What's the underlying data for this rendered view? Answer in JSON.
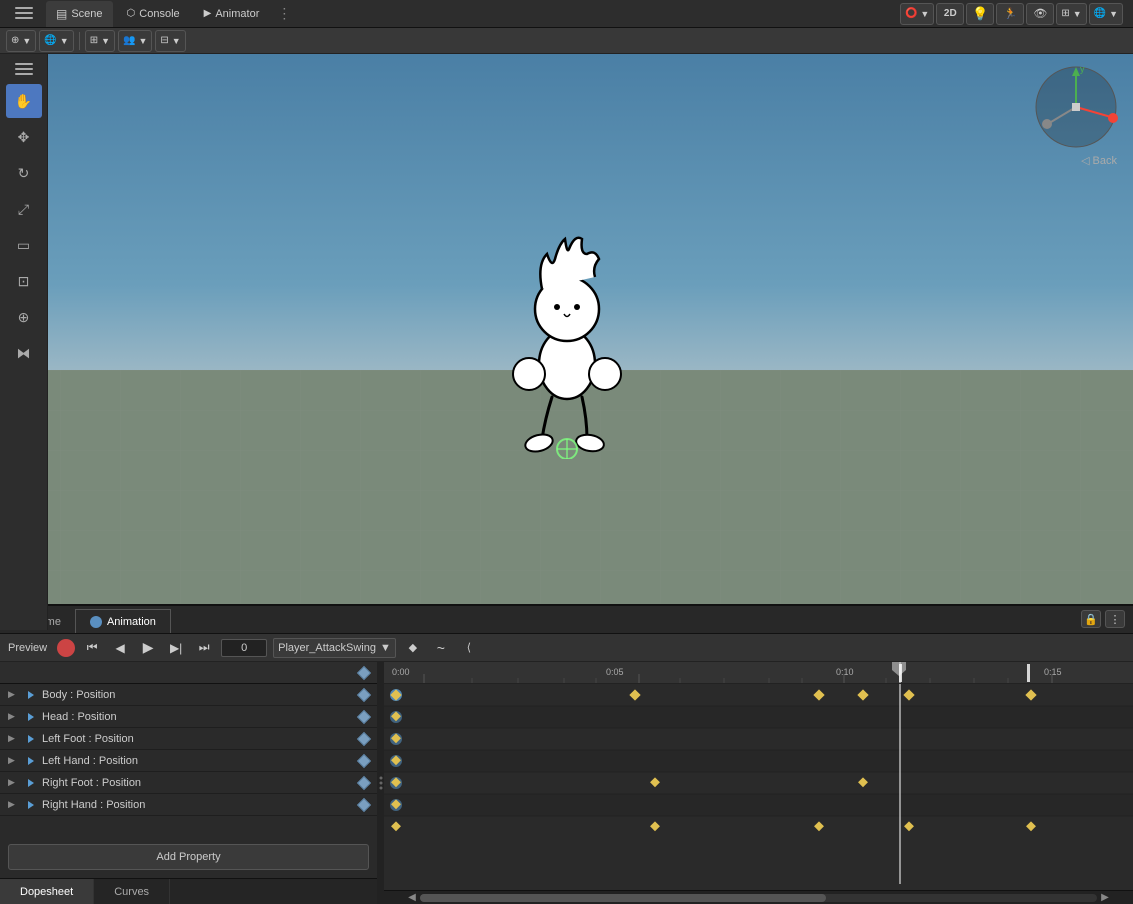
{
  "topBar": {
    "tabs": [
      {
        "id": "scene",
        "label": "Scene",
        "icon": "▤",
        "active": true
      },
      {
        "id": "console",
        "label": "Console",
        "icon": "⬡",
        "active": false
      },
      {
        "id": "animator",
        "label": "Animator",
        "icon": "▶",
        "active": false
      }
    ],
    "overflow_icon": "⋮",
    "toolbar_items": [
      "⊕",
      "🌐",
      "⊞",
      "📷",
      "⊟"
    ],
    "right_items": [
      "⭕",
      "2D",
      "💡",
      "🏃",
      "👁",
      "📹",
      "🌐"
    ]
  },
  "leftTools": {
    "tools": [
      {
        "id": "hand",
        "icon": "✋",
        "active": true
      },
      {
        "id": "move",
        "icon": "✥",
        "active": false
      },
      {
        "id": "rotate",
        "icon": "↻",
        "active": false
      },
      {
        "id": "scale",
        "icon": "⤢",
        "active": false
      },
      {
        "id": "rect",
        "icon": "▭",
        "active": false
      },
      {
        "id": "transform",
        "icon": "⊡",
        "active": false
      },
      {
        "id": "custom1",
        "icon": "⊕",
        "active": false
      },
      {
        "id": "custom2",
        "icon": "⧓",
        "active": false
      }
    ]
  },
  "scene": {
    "back_label": "◁ Back",
    "character_desc": "animated character stick figure"
  },
  "bottomPanel": {
    "tabs": [
      {
        "id": "game",
        "label": "Game",
        "icon": "🎮",
        "active": false
      },
      {
        "id": "animation",
        "label": "Animation",
        "icon": "●",
        "active": true
      }
    ],
    "preview_label": "Preview",
    "record_btn": "●",
    "transport_buttons": [
      "⏮",
      "⏭←",
      "◀",
      "▶",
      "▶▶",
      "⏭"
    ],
    "frame_value": "0",
    "clip_name": "Player_AttackSwing",
    "clip_arrow": "▼",
    "add_keyframe_icon": "◆",
    "anim_curve_icon": "~",
    "collapse_icon": "⟨"
  },
  "propertyPanel": {
    "properties": [
      {
        "id": "body-pos",
        "label": "Body : Position",
        "has_keyframe": true
      },
      {
        "id": "head-pos",
        "label": "Head : Position",
        "has_keyframe": true
      },
      {
        "id": "left-foot-pos",
        "label": "Left Foot : Position",
        "has_keyframe": true
      },
      {
        "id": "left-hand-pos",
        "label": "Left Hand : Position",
        "has_keyframe": true
      },
      {
        "id": "right-foot-pos",
        "label": "Right Foot : Position",
        "has_keyframe": true
      },
      {
        "id": "right-hand-pos",
        "label": "Right Hand : Position",
        "has_keyframe": true
      }
    ],
    "add_property_label": "Add Property"
  },
  "bottomTabs": {
    "tabs": [
      {
        "id": "dopesheet",
        "label": "Dopesheet",
        "active": true
      },
      {
        "id": "curves",
        "label": "Curves",
        "active": false
      }
    ]
  },
  "timeline": {
    "ruler_marks": [
      "0:00",
      "0:05",
      "0:10",
      "0:15"
    ],
    "ruler_positions": [
      0,
      31,
      62,
      93
    ],
    "keyframes": {
      "track0": [
        0,
        31,
        55,
        62,
        68,
        93
      ],
      "track1": [
        0
      ],
      "track2": [
        0
      ],
      "track3": [
        0,
        38,
        62
      ],
      "track4": [
        0
      ],
      "track5": [
        0,
        38,
        55,
        62,
        68,
        93
      ]
    }
  },
  "colors": {
    "accent_blue": "#4d78c0",
    "keyframe_gold": "#e0c050",
    "record_red": "#cc4444",
    "bg_dark": "#2a2a2a",
    "bg_medium": "#333333",
    "bg_light": "#3a3a3a",
    "border": "#222222",
    "text_light": "#cccccc",
    "text_dim": "#888888"
  }
}
